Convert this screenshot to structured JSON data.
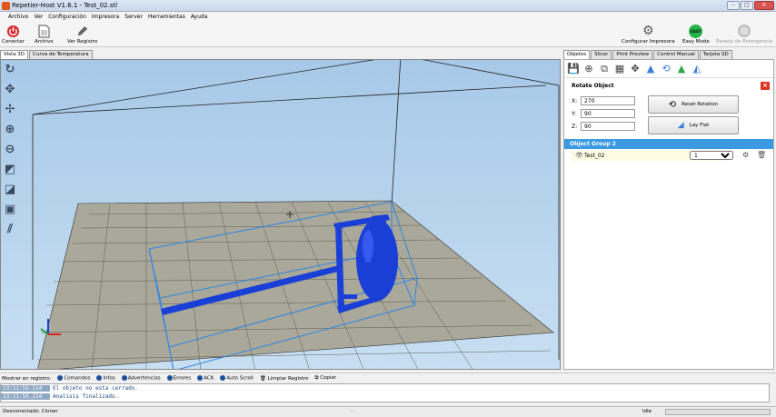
{
  "window": {
    "title": "Repetier-Host V1.6.1 - Test_02.stl",
    "min": "–",
    "max": "□",
    "close": "✕"
  },
  "menu": [
    "Archivo",
    "Ver",
    "Configuración",
    "Impresora",
    "Server",
    "Herramientas",
    "Ayuda"
  ],
  "toolbar": {
    "connect": "Conectar",
    "file": "Archivo",
    "log": "Ver Registro",
    "config_printer": "Configurar Impresora",
    "easy_mode": "Easy Mode",
    "easy_badge": "EASY",
    "emergency": "Parada de Emergencia"
  },
  "left_tabs": [
    "Vista 3D",
    "Curva de Temperatura"
  ],
  "right_tabs": [
    "Objetos",
    "Slicer",
    "Print Preview",
    "Control Manual",
    "Tarjeta SD"
  ],
  "rotate": {
    "title": "Rotate Object",
    "x_label": "X:",
    "x_value": "270",
    "y_label": "Y:",
    "y_value": "90",
    "z_label": "Z:",
    "z_value": "90",
    "reset": "Reset Rotation",
    "lay_flat": "Lay Flat"
  },
  "objects": {
    "group": "Object Group 2",
    "item": "Test_02",
    "count": "1"
  },
  "log_toolbar": {
    "show": "Mostrar en registro:",
    "commands": "Comandos",
    "infos": "Infos",
    "warnings": "Advertencias",
    "errors": "Errores",
    "ack": "ACK",
    "autoscroll": "Auto Scroll",
    "clear": "Limpiar Registro",
    "copy": "Copiar"
  },
  "log": [
    {
      "time": "13:11:55.214",
      "msg": "El objeto no esta cerrado."
    },
    {
      "time": "13:11:55.214",
      "msg": "Analisis finalizado."
    }
  ],
  "status": {
    "connection": "Desconectado: Cloner",
    "middle": "-",
    "state": "Idle"
  },
  "colors": {
    "accent": "#3b9ae1",
    "model": "#1a3fd6",
    "bbox": "#2f86e6",
    "bed": "#a9a89a"
  }
}
